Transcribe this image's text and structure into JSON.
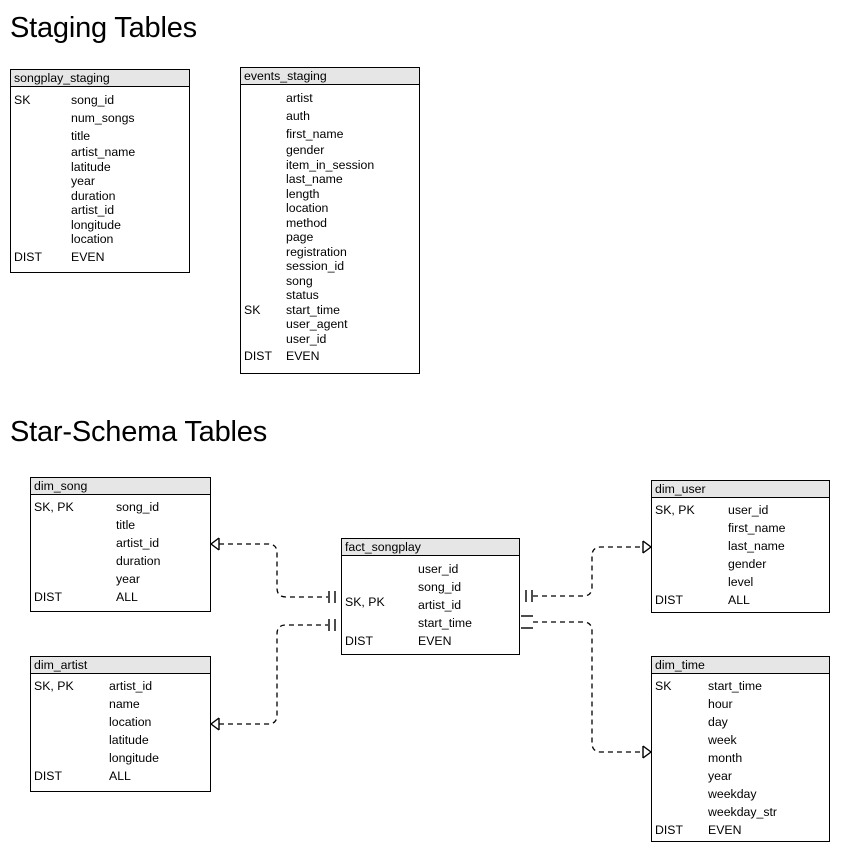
{
  "sections": {
    "staging_title": "Staging Tables",
    "star_title": "Star-Schema Tables"
  },
  "colors": {
    "header_fill": "#e6e6e6",
    "border": "#000000",
    "background": "#ffffff",
    "text": "#000000"
  },
  "tables": {
    "songplay_staging": {
      "name": "songplay_staging",
      "rows": [
        {
          "key": "SK",
          "attr": "song_id"
        },
        {
          "key": "",
          "attr": "num_songs"
        },
        {
          "key": "",
          "attr": "title"
        },
        {
          "key": "",
          "attr": "artist_name"
        },
        {
          "key": "",
          "attr": "latitude"
        },
        {
          "key": "",
          "attr": "year"
        },
        {
          "key": "",
          "attr": "duration"
        },
        {
          "key": "",
          "attr": "artist_id"
        },
        {
          "key": "",
          "attr": "longitude"
        },
        {
          "key": "",
          "attr": "location"
        },
        {
          "key": "DIST",
          "attr": "EVEN"
        }
      ]
    },
    "events_staging": {
      "name": "events_staging",
      "rows": [
        {
          "key": "",
          "attr": "artist"
        },
        {
          "key": "",
          "attr": "auth"
        },
        {
          "key": "",
          "attr": "first_name"
        },
        {
          "key": "",
          "attr": "gender"
        },
        {
          "key": "",
          "attr": "item_in_session"
        },
        {
          "key": "",
          "attr": "last_name"
        },
        {
          "key": "",
          "attr": "length"
        },
        {
          "key": "",
          "attr": "location"
        },
        {
          "key": "",
          "attr": "method"
        },
        {
          "key": "",
          "attr": "page"
        },
        {
          "key": "",
          "attr": "registration"
        },
        {
          "key": "",
          "attr": "session_id"
        },
        {
          "key": "",
          "attr": "song"
        },
        {
          "key": "",
          "attr": "status"
        },
        {
          "key": "SK",
          "attr": "start_time"
        },
        {
          "key": "",
          "attr": "user_agent"
        },
        {
          "key": "",
          "attr": "user_id"
        },
        {
          "key": "DIST",
          "attr": "EVEN"
        }
      ]
    },
    "dim_song": {
      "name": "dim_song",
      "rows": [
        {
          "key": "SK, PK",
          "attr": "song_id"
        },
        {
          "key": "",
          "attr": "title"
        },
        {
          "key": "",
          "attr": "artist_id"
        },
        {
          "key": "",
          "attr": "duration"
        },
        {
          "key": "",
          "attr": "year"
        },
        {
          "key": "DIST",
          "attr": "ALL"
        }
      ]
    },
    "dim_artist": {
      "name": "dim_artist",
      "rows": [
        {
          "key": "SK, PK",
          "attr": "artist_id"
        },
        {
          "key": "",
          "attr": "name"
        },
        {
          "key": "",
          "attr": "location"
        },
        {
          "key": "",
          "attr": "latitude"
        },
        {
          "key": "",
          "attr": "longitude"
        },
        {
          "key": "DIST",
          "attr": "ALL"
        }
      ]
    },
    "fact_songplay": {
      "name": "fact_songplay",
      "key_label": "SK, PK",
      "rows": [
        {
          "key": "",
          "attr": "user_id"
        },
        {
          "key": "",
          "attr": "song_id"
        },
        {
          "key": "",
          "attr": "artist_id"
        },
        {
          "key": "",
          "attr": "start_time"
        },
        {
          "key": "DIST",
          "attr": "EVEN"
        }
      ]
    },
    "dim_user": {
      "name": "dim_user",
      "rows": [
        {
          "key": "SK, PK",
          "attr": "user_id"
        },
        {
          "key": "",
          "attr": "first_name"
        },
        {
          "key": "",
          "attr": "last_name"
        },
        {
          "key": "",
          "attr": "gender"
        },
        {
          "key": "",
          "attr": "level"
        },
        {
          "key": "DIST",
          "attr": "ALL"
        }
      ]
    },
    "dim_time": {
      "name": "dim_time",
      "rows": [
        {
          "key": "SK",
          "attr": "start_time"
        },
        {
          "key": "",
          "attr": "hour"
        },
        {
          "key": "",
          "attr": "day"
        },
        {
          "key": "",
          "attr": "week"
        },
        {
          "key": "",
          "attr": "month"
        },
        {
          "key": "",
          "attr": "year"
        },
        {
          "key": "",
          "attr": "weekday"
        },
        {
          "key": "",
          "attr": "weekday_str"
        },
        {
          "key": "DIST",
          "attr": "EVEN"
        }
      ]
    }
  },
  "relationships": [
    {
      "name": "dim_song-to-fact_songplay",
      "from": "dim_song",
      "to": "fact_songplay",
      "from_cardinality": "many",
      "to_cardinality": "one"
    },
    {
      "name": "dim_artist-to-fact_songplay",
      "from": "dim_artist",
      "to": "fact_songplay",
      "from_cardinality": "many",
      "to_cardinality": "one"
    },
    {
      "name": "fact_songplay-to-dim_user",
      "from": "fact_songplay",
      "to": "dim_user",
      "from_cardinality": "one",
      "to_cardinality": "many"
    },
    {
      "name": "fact_songplay-to-dim_time",
      "from": "fact_songplay",
      "to": "dim_time",
      "from_cardinality": "one",
      "to_cardinality": "many"
    }
  ]
}
